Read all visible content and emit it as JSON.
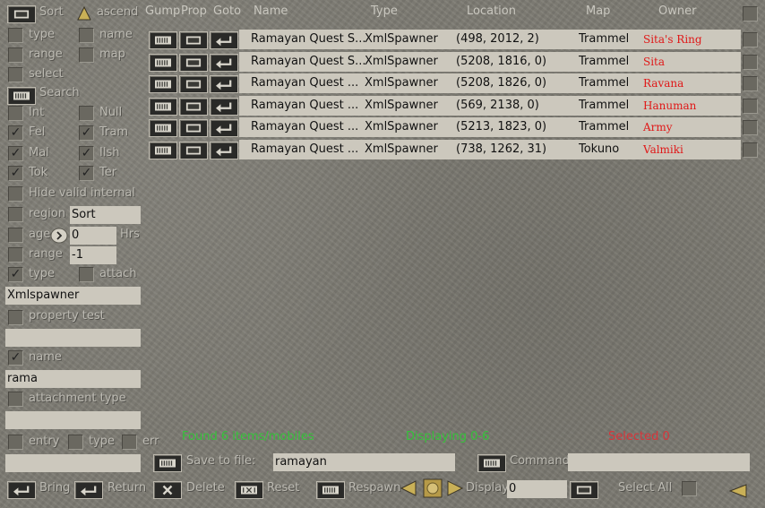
{
  "colors": {
    "status_green": "#35c23a",
    "status_red": "#d8343a",
    "owner_red": "#e01818"
  },
  "sort": {
    "label": "Sort",
    "ascend_label": "ascend"
  },
  "sort_options": {
    "type": "type",
    "name": "name",
    "range": "range",
    "map": "map",
    "select": "select"
  },
  "search": {
    "label": "Search"
  },
  "filters": {
    "int": "Int",
    "null": "Null",
    "fel": "Fel",
    "tram": "Tram",
    "mal": "Mal",
    "ilsh": "Ilsh",
    "tok": "Tok",
    "ter": "Ter",
    "hide_valid_internal": "Hide valid internal"
  },
  "region": {
    "label": "region",
    "value": "Sort"
  },
  "age": {
    "label": "age",
    "value": "0",
    "unit": "Hrs"
  },
  "range": {
    "label": "range",
    "value": "-1"
  },
  "type_filter": {
    "label": "type",
    "attach_label": "attach",
    "value": "Xmlspawner"
  },
  "property_test": {
    "label": "property test",
    "value": ""
  },
  "name_filter": {
    "label": "name",
    "value": "rama"
  },
  "attachment_type": {
    "label": "attachment type",
    "value": ""
  },
  "entry_row": {
    "entry": "entry",
    "type": "type",
    "err": "err",
    "value": ""
  },
  "columns": {
    "gump": "Gump",
    "prop": "Prop",
    "goto": "Goto",
    "name": "Name",
    "type": "Type",
    "location": "Location",
    "map": "Map",
    "owner": "Owner"
  },
  "results": [
    {
      "name": "Ramayan Quest S...",
      "type": "XmlSpawner",
      "location": "(498, 2012, 2)",
      "map": "Trammel",
      "owner": "Sita's Ring"
    },
    {
      "name": "Ramayan Quest S...",
      "type": "XmlSpawner",
      "location": "(5208, 1816, 0)",
      "map": "Trammel",
      "owner": "Sita"
    },
    {
      "name": "Ramayan Quest ...",
      "type": "XmlSpawner",
      "location": "(5208, 1826, 0)",
      "map": "Trammel",
      "owner": "Ravana"
    },
    {
      "name": "Ramayan Quest ...",
      "type": "XmlSpawner",
      "location": "(569, 2138, 0)",
      "map": "Trammel",
      "owner": "Hanuman"
    },
    {
      "name": "Ramayan Quest ...",
      "type": "XmlSpawner",
      "location": "(5213, 1823, 0)",
      "map": "Trammel",
      "owner": "Army"
    },
    {
      "name": "Ramayan Quest ...",
      "type": "XmlSpawner",
      "location": "(738, 1262, 31)",
      "map": "Tokuno",
      "owner": "Valmiki"
    }
  ],
  "status": {
    "found": "Found 6 items/mobiles",
    "displaying": "Displaying 0-6",
    "selected": "Selected 0"
  },
  "save": {
    "label": "Save to file:",
    "value": "ramayan"
  },
  "command": {
    "label": "Command:",
    "value": ""
  },
  "bottom": {
    "bring": "Bring",
    "return": "Return",
    "delete": "Delete",
    "reset": "Reset",
    "respawn": "Respawn",
    "display": "Display",
    "display_value": "0",
    "select_all": "Select All"
  }
}
